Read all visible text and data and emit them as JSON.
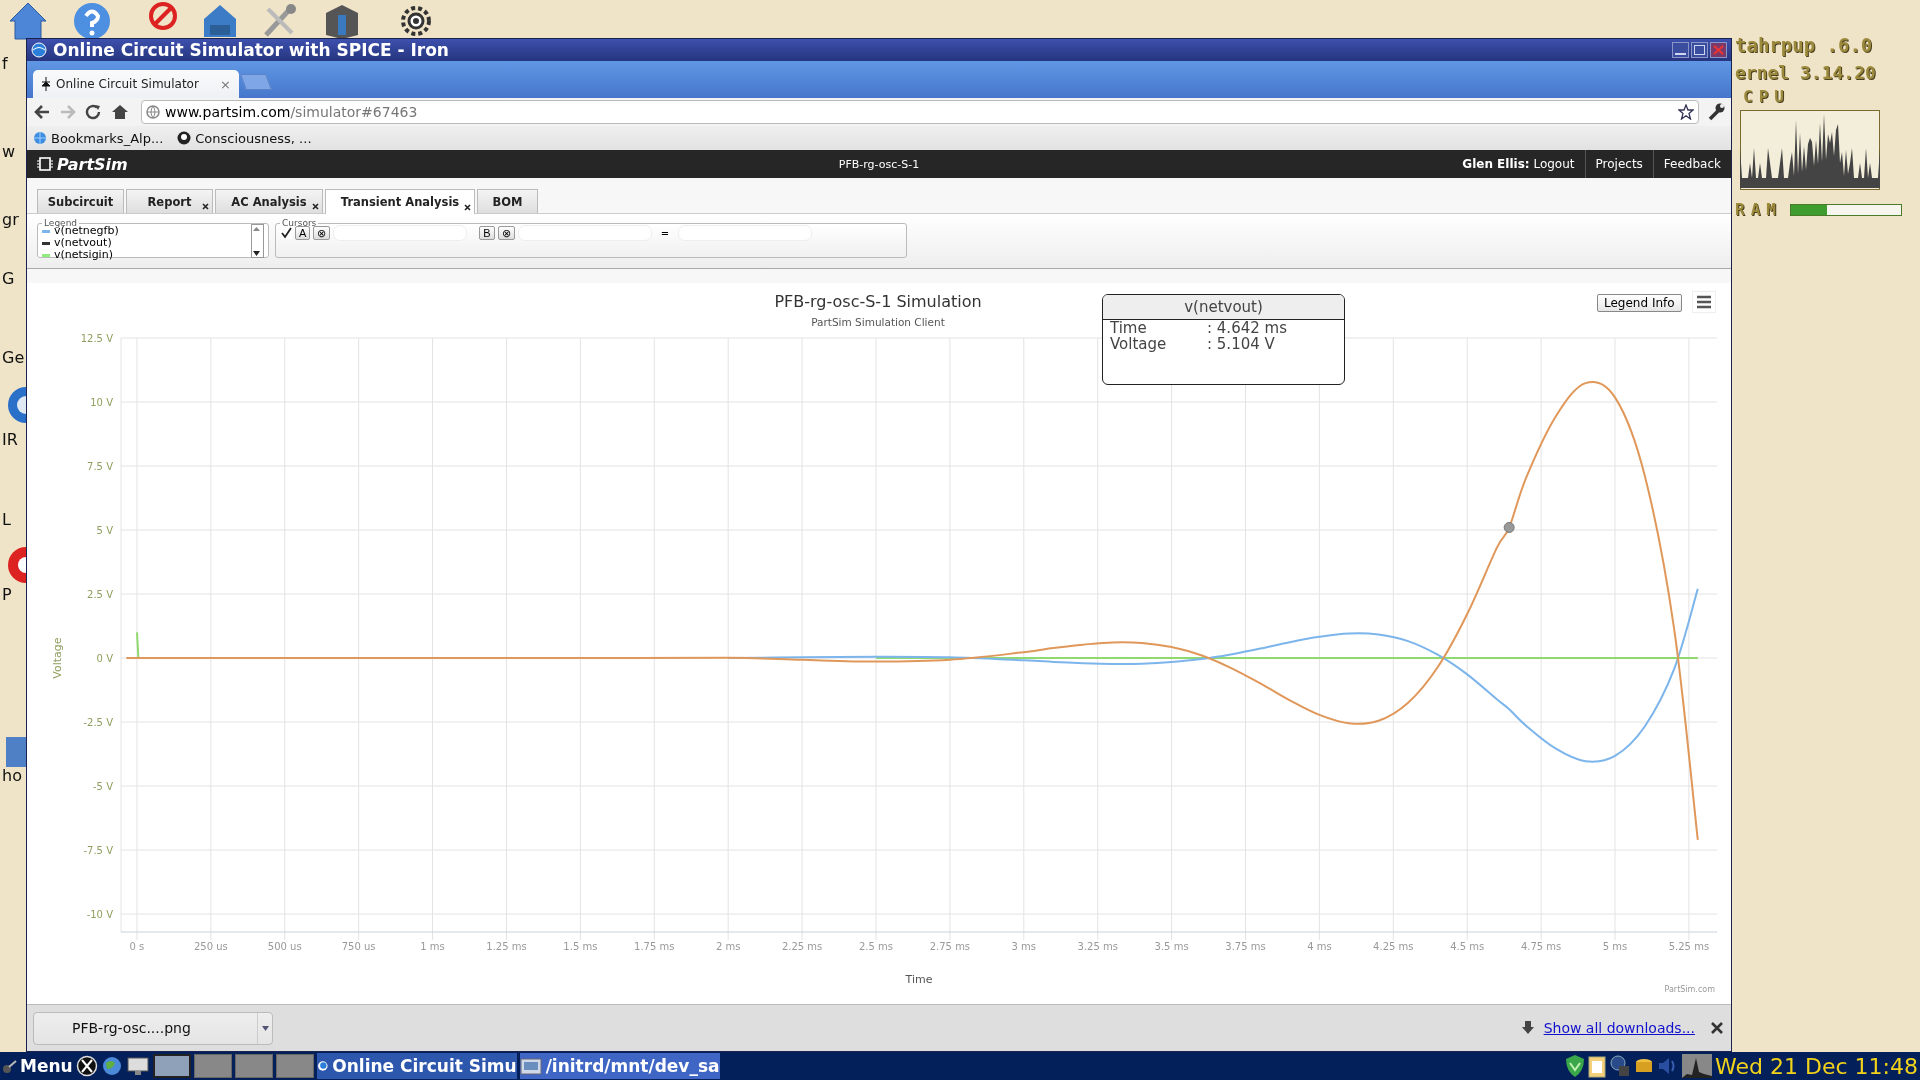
{
  "desktop": {
    "labels": [
      "f",
      "w",
      "gr",
      "G",
      "Ge",
      "IR",
      "L",
      "P",
      "ho"
    ]
  },
  "conky": {
    "distro": "tahrpup .6.0",
    "kernel": "ernel 3.14.20",
    "cpu_label": "CPU",
    "ram": {
      "label": "RAM",
      "level": 0.33
    }
  },
  "window": {
    "title": "Online Circuit Simulator with SPICE - Iron"
  },
  "browser": {
    "tab": {
      "title": "Online Circuit Simulator",
      "close": "×"
    },
    "address": {
      "domain": "www.partsim.com",
      "path": "/simulator#67463"
    },
    "bookmarks": [
      "Bookmarks_Alp...",
      "Consciousness, ..."
    ]
  },
  "app": {
    "logo": "PartSim",
    "project": "PFB-rg-osc-S-1",
    "user": "Glen Ellis:",
    "logout": "Logout",
    "nav": [
      "Projects",
      "Feedback"
    ]
  },
  "analysis_tabs": [
    {
      "label": "Subcircuit",
      "closable": false,
      "selected": false
    },
    {
      "label": "Report",
      "closable": true,
      "selected": false
    },
    {
      "label": "AC Analysis",
      "closable": true,
      "selected": false
    },
    {
      "label": "Transient Analysis",
      "closable": true,
      "selected": true
    },
    {
      "label": "BOM",
      "closable": false,
      "selected": false
    }
  ],
  "legend": {
    "title": "Legend",
    "items": [
      {
        "color": "#7cb5ec"
      },
      {
        "color": "#333333"
      },
      {
        "color": "#90ed7d"
      }
    ]
  },
  "cursors": {
    "title": "Cursors",
    "checked": true,
    "a_label": "A",
    "a_clear": "⊗",
    "b_label": "B",
    "b_clear": "⊗",
    "equals": "="
  },
  "chart": {
    "subtitle": "PartSim Simulation Client",
    "legend_button": "Legend Info",
    "credit": "PartSim.com",
    "us_tick_labels": [
      "250 us",
      "500 us",
      "750 us"
    ],
    "tooltip": {
      "title": "v(netvout)",
      "rows": [
        {
          "label": "Time",
          "value": ": 4.642 ms"
        },
        {
          "label": "Voltage",
          "value": ": 5.104 V"
        }
      ]
    },
    "chart_data": {
      "type": "line",
      "title": "PFB-rg-osc-S-1 Simulation",
      "xlabel": "Time",
      "ylabel": "Voltage",
      "x": [
        0,
        0.005,
        0.5,
        1,
        1.5,
        2,
        2.25,
        2.5,
        2.75,
        3,
        3.1,
        3.2,
        3.3,
        3.4,
        3.5,
        3.6,
        3.7,
        3.8,
        3.9,
        4,
        4.1,
        4.2,
        4.3,
        4.4,
        4.5,
        4.6,
        4.642,
        4.7,
        4.8,
        4.9,
        5,
        5.1,
        5.2,
        5.28
      ],
      "series": [
        {
          "name": "v(netnegfb)",
          "color": "#7cb5ec",
          "values": [
            null,
            null,
            null,
            null,
            null,
            0,
            0.03,
            0.05,
            0.03,
            -0.09,
            -0.15,
            -0.2,
            -0.23,
            -0.22,
            -0.16,
            -0.04,
            0.14,
            0.37,
            0.62,
            0.83,
            0.96,
            0.92,
            0.66,
            0.13,
            -0.64,
            -1.61,
            -2.0,
            -2.65,
            -3.54,
            -4.03,
            -3.82,
            -2.68,
            -0.43,
            2.7
          ]
        },
        {
          "name": "v(netvout)",
          "color": "#e0975a",
          "values": [
            0,
            0,
            0,
            0,
            0,
            0.01,
            -0.07,
            -0.14,
            -0.07,
            0.23,
            0.39,
            0.52,
            0.61,
            0.59,
            0.43,
            0.11,
            -0.38,
            -0.99,
            -1.65,
            -2.22,
            -2.55,
            -2.45,
            -1.75,
            -0.36,
            1.72,
            4.3,
            5.1,
            7.06,
            9.44,
            10.74,
            10.18,
            7.15,
            1.15,
            -7.1
          ]
        },
        {
          "name": "v(netsigin)",
          "color": "#90d96e",
          "values": [
            1,
            0,
            null,
            null,
            null,
            null,
            null,
            0,
            0,
            0,
            0,
            0,
            0,
            0,
            0,
            0,
            0,
            0,
            0,
            0,
            0,
            0,
            0,
            0,
            0,
            0,
            0,
            0,
            0,
            0,
            0,
            0,
            0,
            0
          ]
        }
      ],
      "xlim": [
        -0.054,
        5.345
      ],
      "ylim": [
        -10.7,
        12.5
      ],
      "grid": true,
      "xticks": [
        {
          "value": 0,
          "label": "0 s"
        },
        {
          "value": 1,
          "label": "1 ms"
        },
        {
          "value": 1.25,
          "label": "1.25 ms"
        },
        {
          "value": 1.5,
          "label": "1.5 ms"
        },
        {
          "value": 1.75,
          "label": "1.75 ms"
        },
        {
          "value": 2,
          "label": "2 ms"
        },
        {
          "value": 2.25,
          "label": "2.25 ms"
        },
        {
          "value": 2.5,
          "label": "2.5 ms"
        },
        {
          "value": 2.75,
          "label": "2.75 ms"
        },
        {
          "value": 3,
          "label": "3 ms"
        },
        {
          "value": 3.25,
          "label": "3.25 ms"
        },
        {
          "value": 3.5,
          "label": "3.5 ms"
        },
        {
          "value": 3.75,
          "label": "3.75 ms"
        },
        {
          "value": 4,
          "label": "4 ms"
        },
        {
          "value": 4.25,
          "label": "4.25 ms"
        },
        {
          "value": 4.5,
          "label": "4.5 ms"
        },
        {
          "value": 4.75,
          "label": "4.75 ms"
        },
        {
          "value": 5,
          "label": "5 ms"
        },
        {
          "value": 5.25,
          "label": "5.25 ms"
        }
      ],
      "yticks": [
        {
          "value": 12.5,
          "label": "12.5 V"
        },
        {
          "value": 10,
          "label": "10 V"
        },
        {
          "value": 7.5,
          "label": "7.5 V"
        },
        {
          "value": 5,
          "label": "5 V"
        },
        {
          "value": 2.5,
          "label": "2.5 V"
        },
        {
          "value": 0,
          "label": "0 V"
        },
        {
          "value": -2.5,
          "label": "-2.5 V"
        },
        {
          "value": -5,
          "label": "-5 V"
        },
        {
          "value": -7.5,
          "label": "-7.5 V"
        },
        {
          "value": -10,
          "label": "-10 V"
        }
      ]
    }
  },
  "downloads": {
    "file": "PFB-rg-osc....png",
    "show_all": "Show all downloads..."
  },
  "taskbar": {
    "menu": "Menu",
    "tasks": [
      "Online Circuit Simu",
      "/initrd/mnt/dev_sa"
    ],
    "clock": "Wed 21 Dec 11:48"
  }
}
